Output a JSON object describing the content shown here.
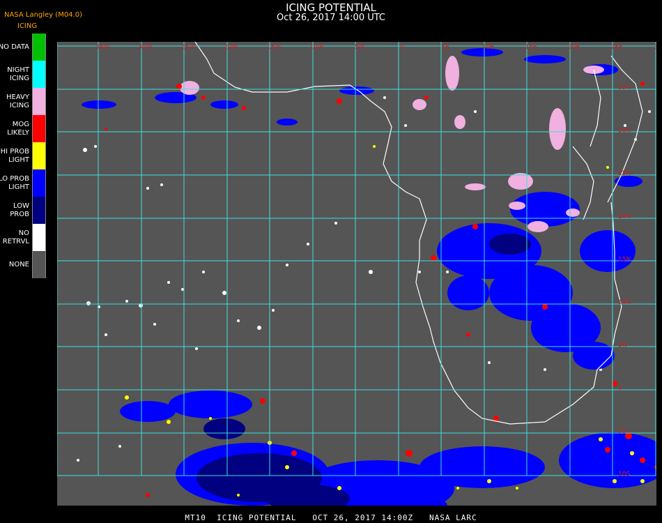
{
  "header": {
    "title": "ICING POTENTIAL",
    "subtitle": "Oct 26, 2017 14:00 UTC",
    "org_label": "NASA Langley (M04.0)",
    "product_label": "ICING"
  },
  "legend": [
    {
      "lines": [
        "NO DATA"
      ],
      "color": "#00c000"
    },
    {
      "lines": [
        "NIGHT",
        "ICING"
      ],
      "color": "#00ffff"
    },
    {
      "lines": [
        "HEAVY",
        "ICING"
      ],
      "color": "#f0b0e0"
    },
    {
      "lines": [
        "MOG",
        "LIKELY"
      ],
      "color": "#ff0000"
    },
    {
      "lines": [
        "HI PROB",
        "LIGHT"
      ],
      "color": "#ffff00"
    },
    {
      "lines": [
        "LO PROB",
        "LIGHT"
      ],
      "color": "#0000ff"
    },
    {
      "lines": [
        "LOW",
        "PROB"
      ],
      "color": "#000080"
    },
    {
      "lines": [
        "NO",
        "RETRVL"
      ],
      "color": "#ffffff"
    },
    {
      "lines": [
        "NONE"
      ],
      "color": "#555555"
    }
  ],
  "map": {
    "background_color": "#555555",
    "grid_color": "#40e0e0",
    "coastline_color": "#ffffff",
    "label_color": "#cc2222",
    "lon_labels": [
      "35W",
      "30W",
      "25W",
      "20W",
      "15W",
      "10W",
      "5W",
      "0",
      "5E",
      "10E",
      "15E",
      "20E",
      "25E",
      "30E",
      "35E"
    ],
    "lat_labels": [
      "35N",
      "30N",
      "25N",
      "20N",
      "15N",
      "10N",
      "5N",
      "0",
      "5S",
      "10S"
    ]
  },
  "footer": "MT10  ICING POTENTIAL   OCT 26, 2017 14:00Z   NASA LARC"
}
